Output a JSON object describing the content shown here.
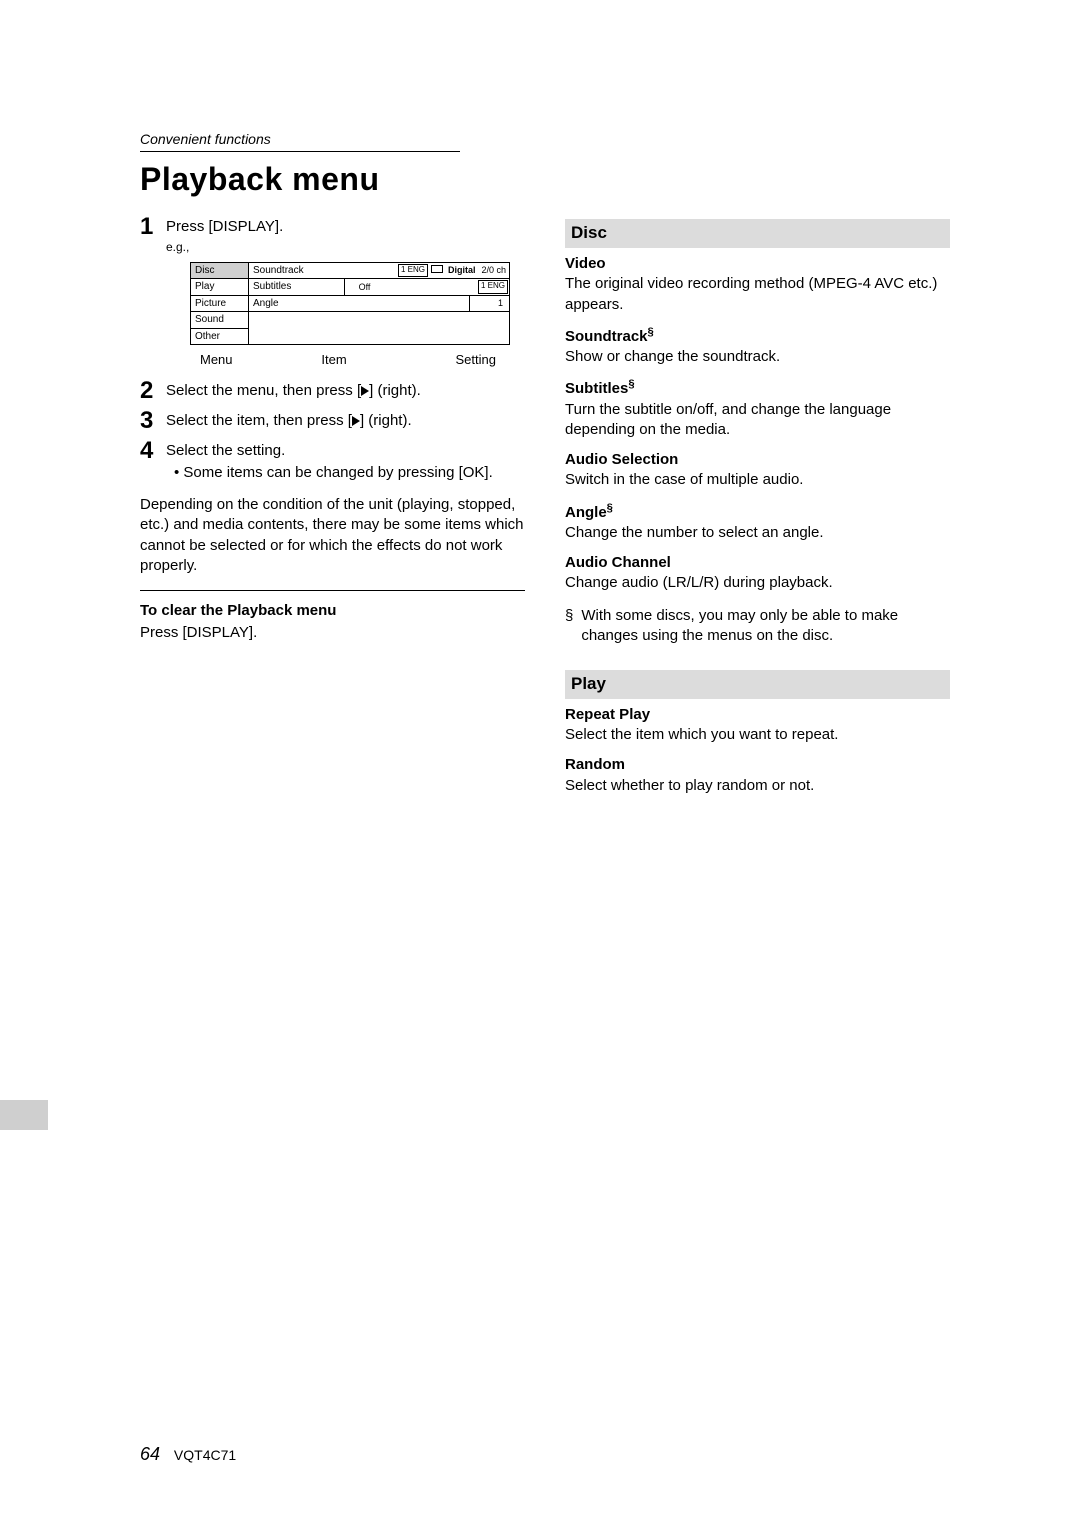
{
  "header": {
    "section_label": "Convenient functions",
    "title": "Playback menu"
  },
  "steps": {
    "s1": {
      "num": "1",
      "text": "Press [DISPLAY].",
      "eg": "e.g.,"
    },
    "s2": {
      "num": "2",
      "text_a": "Select the menu, then press [",
      "text_b": "] (right)."
    },
    "s3": {
      "num": "3",
      "text_a": "Select the item, then press [",
      "text_b": "] (right)."
    },
    "s4": {
      "num": "4",
      "text": "Select the setting.",
      "bullet": "Some items can be changed by pressing [OK]."
    }
  },
  "menu_fig": {
    "left": {
      "disc": "Disc",
      "play": "Play",
      "picture": "Picture",
      "sound": "Sound",
      "other": "Other"
    },
    "rows": {
      "r1": {
        "label": "Soundtrack",
        "chip": "1 ENG",
        "digital": "Digital",
        "ch": "2/0 ch"
      },
      "r2": {
        "label": "Subtitles",
        "val": "Off",
        "chip": "1 ENG"
      },
      "r3": {
        "label": "Angle",
        "val": "1"
      }
    },
    "labels": {
      "menu": "Menu",
      "item": "Item",
      "setting": "Setting"
    }
  },
  "left_col": {
    "depending": "Depending on the condition of the unit (playing, stopped, etc.) and media contents, there may be some items which cannot be selected or for which the effects do not work properly.",
    "clear_head": "To clear the Playback menu",
    "clear_body": "Press [DISPLAY]."
  },
  "right_col": {
    "disc": {
      "section": "Disc",
      "video_h": "Video",
      "video_b": "The original video recording method (MPEG-4 AVC etc.) appears.",
      "soundtrack_h": "Soundtrack",
      "soundtrack_b": "Show or change the soundtrack.",
      "subtitles_h": "Subtitles",
      "subtitles_b": "Turn the subtitle on/off, and change the language depending on the media.",
      "audiosel_h": "Audio Selection",
      "audiosel_b": "Switch in the case of multiple audio.",
      "angle_h": "Angle",
      "angle_b": "Change the number to select an angle.",
      "audioch_h": "Audio Channel",
      "audioch_b": "Change audio (LR/L/R) during playback.",
      "star": "§",
      "footnote": "With some discs, you may only be able to make changes using the menus on the disc."
    },
    "play": {
      "section": "Play",
      "repeat_h": "Repeat Play",
      "repeat_b": "Select the item which you want to repeat.",
      "random_h": "Random",
      "random_b": "Select whether to play random or not."
    }
  },
  "footer": {
    "page": "64",
    "code": "VQT4C71"
  }
}
